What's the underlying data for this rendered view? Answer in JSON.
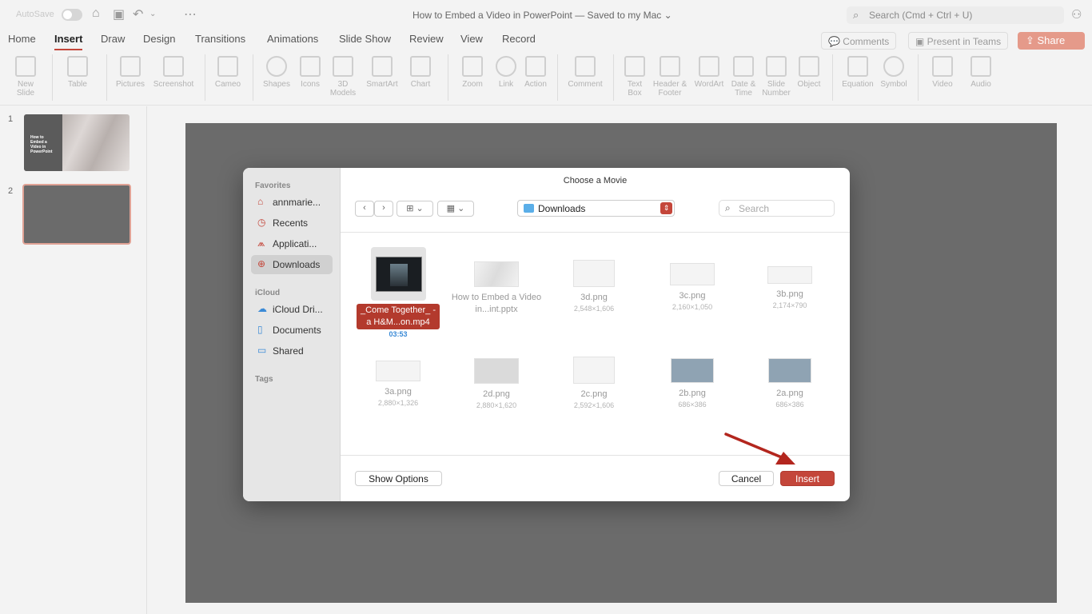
{
  "titlebar": {
    "autosave": "AutoSave",
    "doc_title": "How to Embed a Video in PowerPoint — Saved to my Mac ⌄",
    "search": "Search (Cmd + Ctrl + U)"
  },
  "tabs": [
    "Home",
    "Insert",
    "Draw",
    "Design",
    "Transitions",
    "Animations",
    "Slide Show",
    "Review",
    "View",
    "Record"
  ],
  "active_tab": "Insert",
  "top_buttons": {
    "comments": "Comments",
    "present": "Present in Teams",
    "share": "Share"
  },
  "ribbon": [
    {
      "label": "New\nSlide"
    },
    {
      "label": "Table"
    },
    {
      "label": "Pictures"
    },
    {
      "label": "Screenshot"
    },
    {
      "label": "Cameo"
    },
    {
      "label": "Shapes"
    },
    {
      "label": "Icons"
    },
    {
      "label": "3D\nModels"
    },
    {
      "label": "SmartArt"
    },
    {
      "label": "Chart"
    },
    {
      "label": "Zoom"
    },
    {
      "label": "Link"
    },
    {
      "label": "Action"
    },
    {
      "label": "Comment"
    },
    {
      "label": "Text\nBox"
    },
    {
      "label": "Header &\nFooter"
    },
    {
      "label": "WordArt"
    },
    {
      "label": "Date &\nTime"
    },
    {
      "label": "Slide\nNumber"
    },
    {
      "label": "Object"
    },
    {
      "label": "Equation"
    },
    {
      "label": "Symbol"
    },
    {
      "label": "Video"
    },
    {
      "label": "Audio"
    }
  ],
  "slides": {
    "n1": "1",
    "n2": "2",
    "thumb1_text": "How to Embed a Video in PowerPoint"
  },
  "dialog": {
    "title": "Choose a Movie",
    "location": "Downloads",
    "search_placeholder": "Search",
    "sidebar": {
      "favorites": "Favorites",
      "fav_items": [
        "annmarie...",
        "Recents",
        "Applicati...",
        "Downloads"
      ],
      "icloud": "iCloud",
      "icloud_items": [
        "iCloud Dri...",
        "Documents",
        "Shared"
      ],
      "tags": "Tags"
    },
    "files": [
      {
        "name": "_Come Together_ - a H&M...on.mp4",
        "meta": "03:53"
      },
      {
        "name": "How to Embed a Video in...int.pptx",
        "meta": ""
      },
      {
        "name": "3d.png",
        "meta": "2,548×1,606"
      },
      {
        "name": "3c.png",
        "meta": "2,160×1,050"
      },
      {
        "name": "3b.png",
        "meta": "2,174×790"
      },
      {
        "name": "3a.png",
        "meta": "2,880×1,326"
      },
      {
        "name": "2d.png",
        "meta": "2,880×1,620"
      },
      {
        "name": "2c.png",
        "meta": "2,592×1,606"
      },
      {
        "name": "2b.png",
        "meta": "686×386"
      },
      {
        "name": "2a.png",
        "meta": "686×386"
      }
    ],
    "buttons": {
      "show_options": "Show Options",
      "cancel": "Cancel",
      "insert": "Insert"
    }
  },
  "colors": {
    "accent": "#c4463a",
    "annotation_arrow": "#b3261e"
  }
}
